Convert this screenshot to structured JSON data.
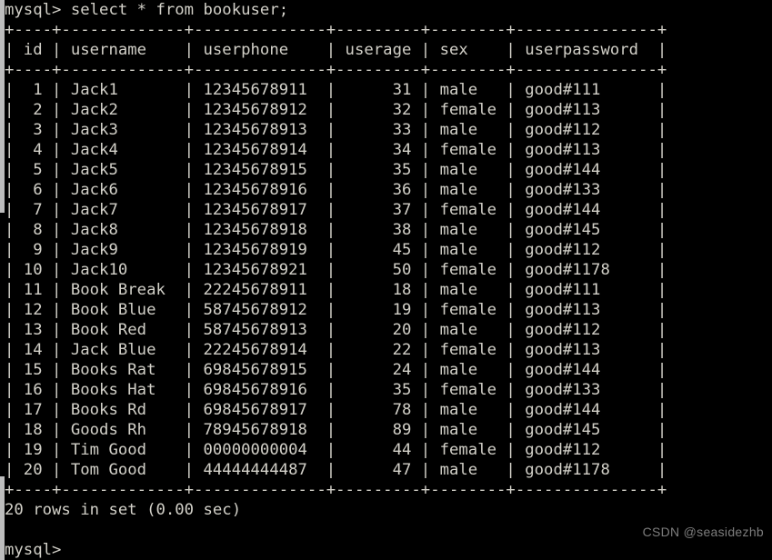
{
  "terminal": {
    "prompt": "mysql>",
    "command": "select * from bookuser;",
    "command_line": "mysql> select * from bookuser;",
    "result_summary": "20 rows in set (0.00 sec)",
    "trailing_prompt": "mysql>",
    "background_color": "#000000",
    "text_color": "#d2d0c8"
  },
  "table": {
    "name": "bookuser",
    "columns": [
      {
        "name": "id",
        "width": 4,
        "align": "right"
      },
      {
        "name": "username",
        "width": 13,
        "align": "left"
      },
      {
        "name": "userphone",
        "width": 14,
        "align": "left"
      },
      {
        "name": "userage",
        "width": 9,
        "align": "right"
      },
      {
        "name": "sex",
        "width": 8,
        "align": "left"
      },
      {
        "name": "userpassword",
        "width": 15,
        "align": "left"
      }
    ],
    "row_count": 20,
    "rows": [
      {
        "id": "1",
        "username": "Jack1",
        "userphone": "12345678911",
        "userage": "31",
        "sex": "male",
        "userpassword": "good#111"
      },
      {
        "id": "2",
        "username": "Jack2",
        "userphone": "12345678912",
        "userage": "32",
        "sex": "female",
        "userpassword": "good#113"
      },
      {
        "id": "3",
        "username": "Jack3",
        "userphone": "12345678913",
        "userage": "33",
        "sex": "male",
        "userpassword": "good#112"
      },
      {
        "id": "4",
        "username": "Jack4",
        "userphone": "12345678914",
        "userage": "34",
        "sex": "female",
        "userpassword": "good#113"
      },
      {
        "id": "5",
        "username": "Jack5",
        "userphone": "12345678915",
        "userage": "35",
        "sex": "male",
        "userpassword": "good#144"
      },
      {
        "id": "6",
        "username": "Jack6",
        "userphone": "12345678916",
        "userage": "36",
        "sex": "male",
        "userpassword": "good#133"
      },
      {
        "id": "7",
        "username": "Jack7",
        "userphone": "12345678917",
        "userage": "37",
        "sex": "female",
        "userpassword": "good#144"
      },
      {
        "id": "8",
        "username": "Jack8",
        "userphone": "12345678918",
        "userage": "38",
        "sex": "male",
        "userpassword": "good#145"
      },
      {
        "id": "9",
        "username": "Jack9",
        "userphone": "12345678919",
        "userage": "45",
        "sex": "male",
        "userpassword": "good#112"
      },
      {
        "id": "10",
        "username": "Jack10",
        "userphone": "12345678921",
        "userage": "50",
        "sex": "female",
        "userpassword": "good#1178"
      },
      {
        "id": "11",
        "username": "Book Break",
        "userphone": "22245678911",
        "userage": "18",
        "sex": "male",
        "userpassword": "good#111"
      },
      {
        "id": "12",
        "username": "Book Blue",
        "userphone": "58745678912",
        "userage": "19",
        "sex": "female",
        "userpassword": "good#113"
      },
      {
        "id": "13",
        "username": "Book Red",
        "userphone": "58745678913",
        "userage": "20",
        "sex": "male",
        "userpassword": "good#112"
      },
      {
        "id": "14",
        "username": "Jack Blue",
        "userphone": "22245678914",
        "userage": "22",
        "sex": "female",
        "userpassword": "good#113"
      },
      {
        "id": "15",
        "username": "Books Rat",
        "userphone": "69845678915",
        "userage": "24",
        "sex": "male",
        "userpassword": "good#144"
      },
      {
        "id": "16",
        "username": "Books Hat",
        "userphone": "69845678916",
        "userage": "35",
        "sex": "female",
        "userpassword": "good#133"
      },
      {
        "id": "17",
        "username": "Books Rd",
        "userphone": "69845678917",
        "userage": "78",
        "sex": "male",
        "userpassword": "good#144"
      },
      {
        "id": "18",
        "username": "Goods Rh",
        "userphone": "78945678918",
        "userage": "89",
        "sex": "male",
        "userpassword": "good#145"
      },
      {
        "id": "19",
        "username": "Tim Good",
        "userphone": "00000000004",
        "userage": "44",
        "sex": "female",
        "userpassword": "good#112"
      },
      {
        "id": "20",
        "username": "Tom Good",
        "userphone": "44444444487",
        "userage": "47",
        "sex": "male",
        "userpassword": "good#1178"
      }
    ]
  },
  "watermark": {
    "text": "CSDN @seasidezhb",
    "color": "#7d7d7d"
  },
  "scrollbar": {
    "track_color": "#bdbdbd",
    "thumb_top_pct": 38,
    "thumb_height_pct": 47
  }
}
